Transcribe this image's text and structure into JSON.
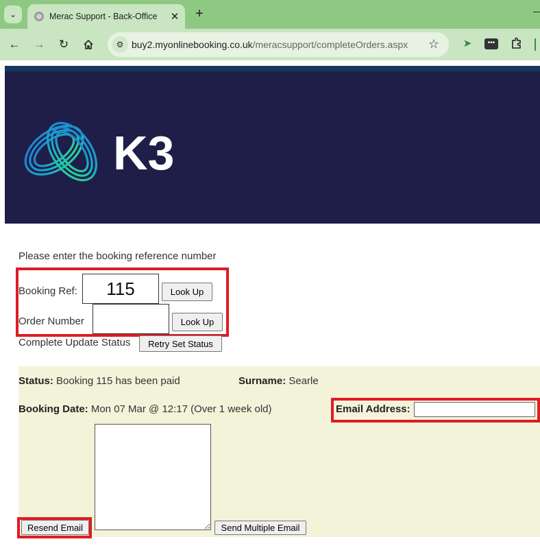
{
  "browser": {
    "tab_title": "Merac Support - Back-Office",
    "url_host": "buy2.myonlinebooking.co.uk",
    "url_path": "/meracsupport/completeOrders.aspx"
  },
  "header": {
    "logo_text": "K3"
  },
  "form": {
    "prompt": "Please enter the booking reference number",
    "booking_ref_label": "Booking Ref:",
    "booking_ref_value": "115",
    "lookup_label_1": "Look Up",
    "order_number_label": "Order Number",
    "order_number_value": "",
    "lookup_label_2": "Look Up",
    "complete_update_label": "Complete Update Status",
    "retry_button": "Retry Set Status"
  },
  "result": {
    "status_label": "Status:",
    "status_value": "Booking 115 has been paid",
    "surname_label": "Surname:",
    "surname_value": "Searle",
    "booking_date_label": "Booking Date:",
    "booking_date_value": "Mon 07 Mar @ 12:17 (Over 1 week old)",
    "email_label": "Email Address:",
    "email_value": "",
    "resend_button": "Resend Email",
    "send_multiple_button": "Send Multiple Email"
  },
  "colors": {
    "banner": "#1f1e48",
    "panel": "#f3f3da",
    "highlight": "#e01b24",
    "chrome": "#c9e5c1"
  }
}
